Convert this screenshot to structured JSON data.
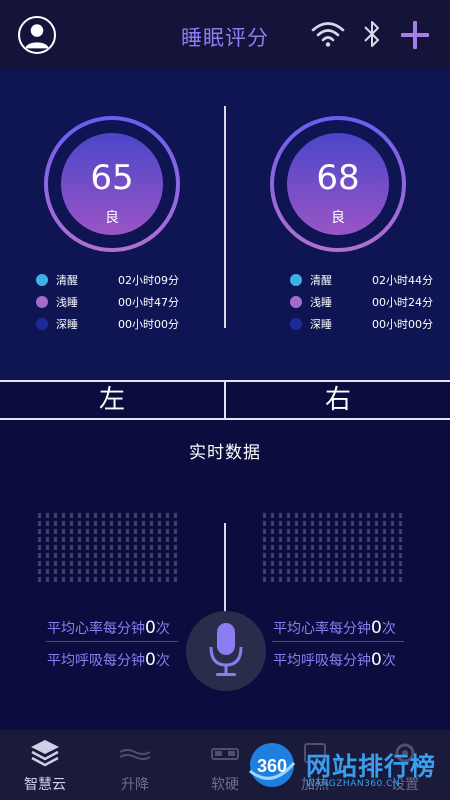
{
  "header": {
    "title": "睡眠评分",
    "icons": [
      "user-avatar-icon",
      "wifi-icon",
      "bluetooth-icon",
      "plus-icon"
    ]
  },
  "colors": {
    "header_bg": "#14143a",
    "panel_bg": "#0f1452",
    "accent": "#8a7df0",
    "awake": "#3fb0e6",
    "light_sleep": "#a36cc8",
    "deep_sleep": "#1c2a9e"
  },
  "left": {
    "score": "65",
    "grade": "良",
    "legend": [
      {
        "label": "清醒",
        "value": "02小时09分",
        "color": "#3fb0e6"
      },
      {
        "label": "浅睡",
        "value": "00小时47分",
        "color": "#a36cc8"
      },
      {
        "label": "深睡",
        "value": "00小时00分",
        "color": "#1c2a9e"
      }
    ]
  },
  "right": {
    "score": "68",
    "grade": "良",
    "legend": [
      {
        "label": "清醒",
        "value": "02小时44分",
        "color": "#3fb0e6"
      },
      {
        "label": "浅睡",
        "value": "00小时24分",
        "color": "#a36cc8"
      },
      {
        "label": "深睡",
        "value": "00小时00分",
        "color": "#1c2a9e"
      }
    ]
  },
  "tabs": {
    "left": "左",
    "right": "右"
  },
  "realtime": {
    "title": "实时数据",
    "left": {
      "heart_label": "平均心率每分钟",
      "heart_value": "0",
      "heart_unit": "次",
      "breath_label": "平均呼吸每分钟",
      "breath_value": "0",
      "breath_unit": "次"
    },
    "right": {
      "heart_label": "平均心率每分钟",
      "heart_value": "0",
      "heart_unit": "次",
      "breath_label": "平均呼吸每分钟",
      "breath_value": "0",
      "breath_unit": "次"
    }
  },
  "nav": {
    "items": [
      {
        "label": "智慧云",
        "icon": "layers-icon",
        "active": true
      },
      {
        "label": "升降",
        "icon": "lift-icon",
        "active": false
      },
      {
        "label": "软硬",
        "icon": "bed-icon",
        "active": false
      },
      {
        "label": "加热",
        "icon": "heat-icon",
        "active": false
      },
      {
        "label": "设置",
        "icon": "gear-icon",
        "active": false
      }
    ]
  },
  "watermark": {
    "badge": "360",
    "text": "网站排行榜",
    "sub": "WANGZHAN360.CN"
  }
}
